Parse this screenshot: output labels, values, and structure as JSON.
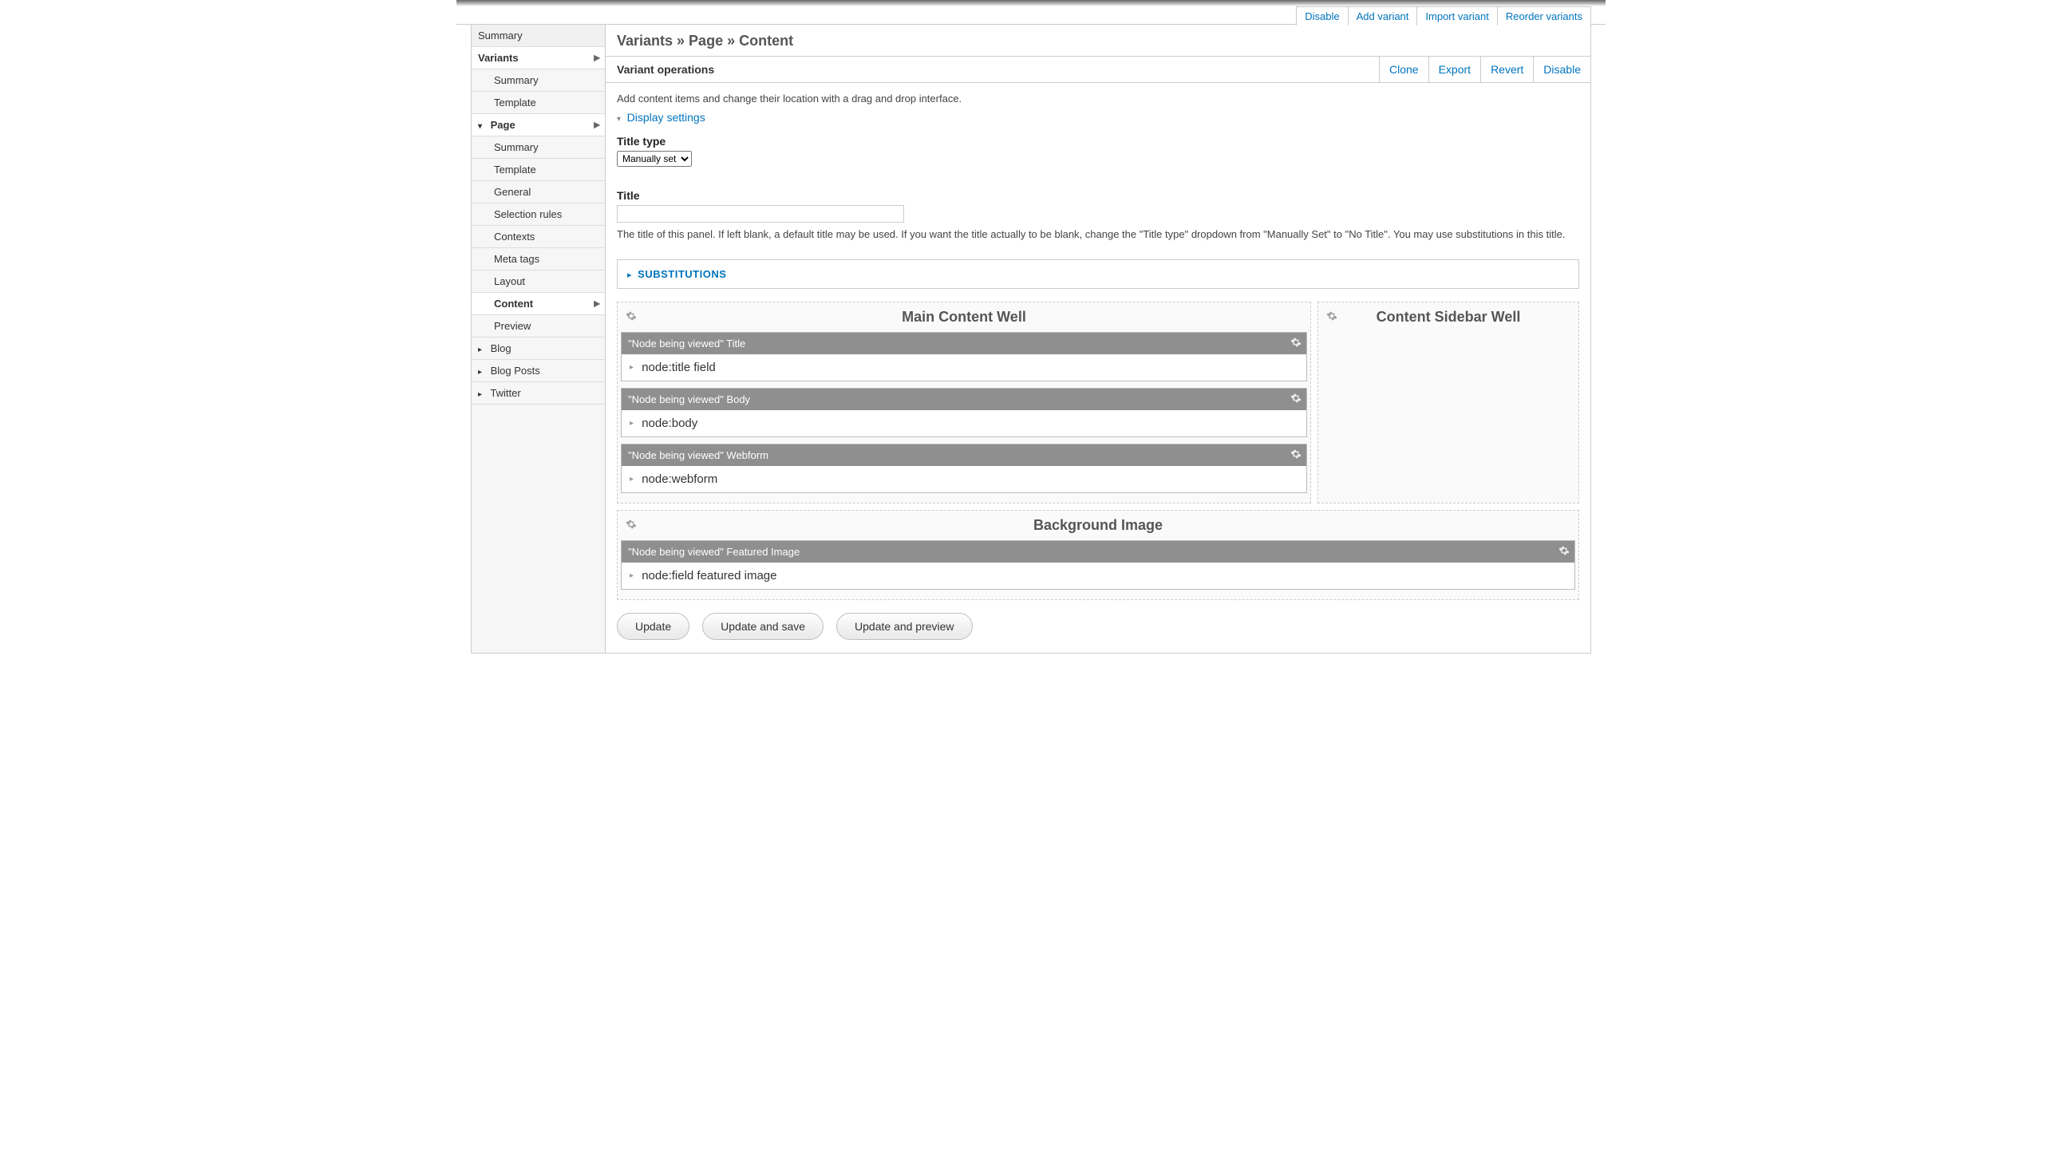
{
  "top_tabs": {
    "disable": "Disable",
    "add_variant": "Add variant",
    "import_variant": "Import variant",
    "reorder_variants": "Reorder variants"
  },
  "sidebar": {
    "summary": "Summary",
    "variants": "Variants",
    "var_summary": "Summary",
    "var_template": "Template",
    "page": "Page",
    "page_summary": "Summary",
    "page_template": "Template",
    "page_general": "General",
    "page_selection_rules": "Selection rules",
    "page_contexts": "Contexts",
    "page_meta_tags": "Meta tags",
    "page_layout": "Layout",
    "page_content": "Content",
    "page_preview": "Preview",
    "blog": "Blog",
    "blog_posts": "Blog Posts",
    "twitter": "Twitter"
  },
  "breadcrumb": "Variants » Page » Content",
  "variant_ops": {
    "title": "Variant operations",
    "clone": "Clone",
    "export": "Export",
    "revert": "Revert",
    "disable": "Disable"
  },
  "intro": "Add content items and change their location with a drag and drop interface.",
  "display_settings": "Display settings",
  "title_type": {
    "label": "Title type",
    "value": "Manually set"
  },
  "title_field": {
    "label": "Title",
    "value": "",
    "description": "The title of this panel. If left blank, a default title may be used. If you want the title actually to be blank, change the \"Title type\" dropdown from \"Manually Set\" to \"No Title\". You may use substitutions in this title."
  },
  "substitutions": "Substitutions",
  "regions": {
    "main": {
      "title": "Main Content Well",
      "panes": [
        {
          "header": "\"Node being viewed\" Title",
          "body": "node:title field"
        },
        {
          "header": "\"Node being viewed\" Body",
          "body": "node:body"
        },
        {
          "header": "\"Node being viewed\" Webform",
          "body": "node:webform"
        }
      ]
    },
    "sidebar": {
      "title": "Content Sidebar Well"
    },
    "background": {
      "title": "Background Image",
      "panes": [
        {
          "header": "\"Node being viewed\" Featured Image",
          "body": "node:field featured image"
        }
      ]
    }
  },
  "actions": {
    "update": "Update",
    "update_save": "Update and save",
    "update_preview": "Update and preview"
  }
}
